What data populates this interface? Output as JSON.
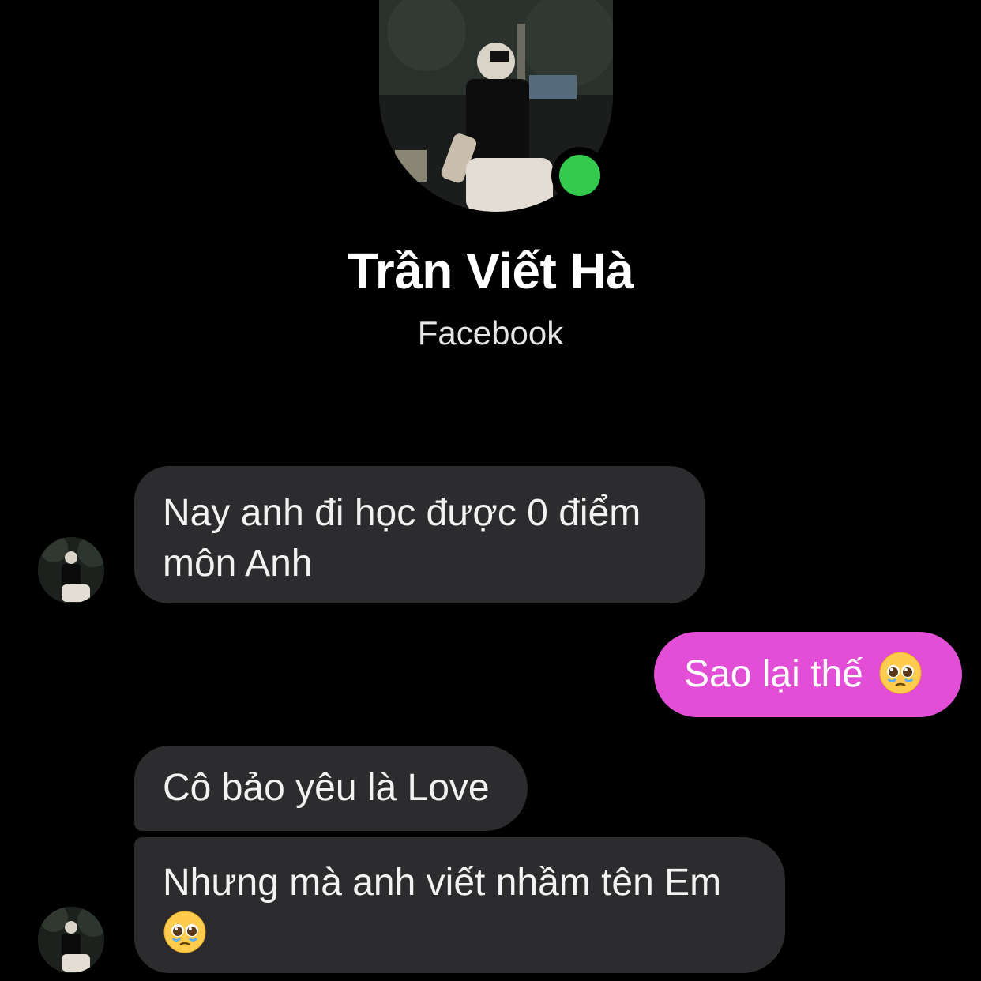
{
  "contact": {
    "name": "Trần Viết Hà",
    "subtitle": "Facebook",
    "status": "online",
    "online_color": "#35c94e"
  },
  "messages": [
    {
      "direction": "incoming",
      "text": "Nay anh đi học được 0 điểm môn Anh"
    },
    {
      "direction": "outgoing",
      "text": "Sao lại thế",
      "emoji": "pleading-face"
    },
    {
      "direction": "incoming",
      "text": "Cô bảo yêu là Love"
    },
    {
      "direction": "incoming",
      "text": "Nhưng mà anh viết nhầm tên Em",
      "emoji": "pleading-face"
    }
  ],
  "colors": {
    "background": "#000000",
    "incoming_bubble": "#2c2c2e",
    "outgoing_bubble": "#e24fd6"
  }
}
